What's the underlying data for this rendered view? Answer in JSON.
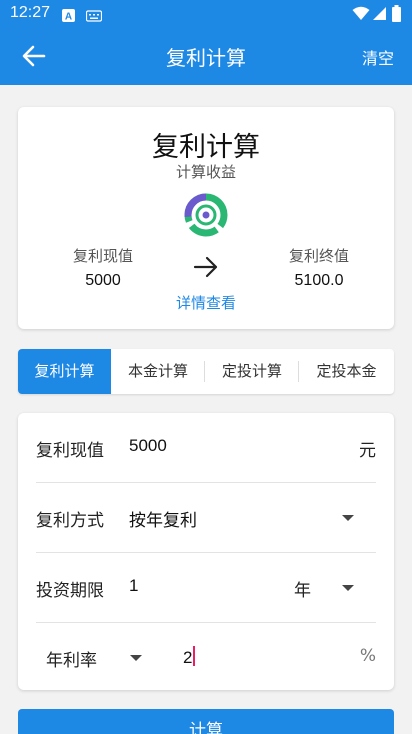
{
  "status_bar": {
    "time": "12:27"
  },
  "app_bar": {
    "title": "复利计算",
    "clear_label": "清空"
  },
  "summary": {
    "title": "复利计算",
    "subtitle": "计算收益",
    "present_value_label": "复利现值",
    "present_value": "5000",
    "future_value_label": "复利终值",
    "future_value": "5100.0",
    "detail_link": "详情查看"
  },
  "tabs": [
    {
      "label": "复利计算",
      "active": true
    },
    {
      "label": "本金计算",
      "active": false
    },
    {
      "label": "定投计算",
      "active": false
    },
    {
      "label": "定投本金",
      "active": false
    }
  ],
  "form": {
    "present_value": {
      "label": "复利现值",
      "value": "5000",
      "unit": "元"
    },
    "compound_method": {
      "label": "复利方式",
      "value": "按年复利"
    },
    "period": {
      "label": "投资期限",
      "value": "1",
      "unit": "年"
    },
    "rate": {
      "label": "年利率",
      "value": "2",
      "unit": "%"
    }
  },
  "calculate_button": "计算",
  "colors": {
    "primary": "#1e88e5",
    "cursor": "#e91e63"
  }
}
